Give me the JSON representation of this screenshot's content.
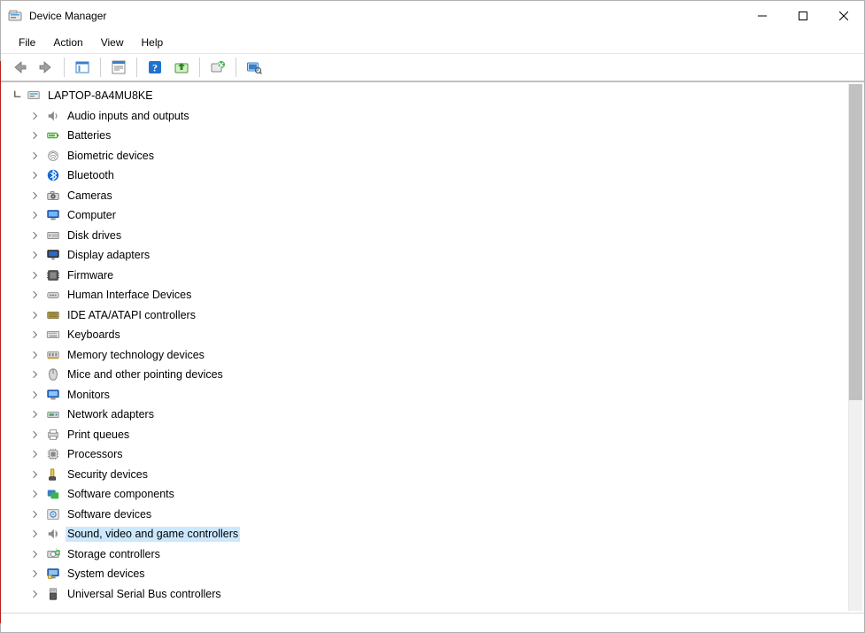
{
  "window": {
    "title": "Device Manager"
  },
  "menu": {
    "items": [
      {
        "label": "File"
      },
      {
        "label": "Action"
      },
      {
        "label": "View"
      },
      {
        "label": "Help"
      }
    ]
  },
  "toolbar": {
    "back": "back-icon",
    "forward": "forward-icon",
    "show_hide_console": "console-tree-icon",
    "properties": "properties-icon",
    "help": "help-icon",
    "update_driver": "update-driver-icon",
    "uninstall": "uninstall-icon",
    "scan": "scan-icon"
  },
  "tree": {
    "root": {
      "label": "LAPTOP-8A4MU8KE",
      "expanded": true
    },
    "categories": [
      {
        "icon": "audio-icon",
        "label": "Audio inputs and outputs"
      },
      {
        "icon": "battery-icon",
        "label": "Batteries"
      },
      {
        "icon": "biometric-icon",
        "label": "Biometric devices"
      },
      {
        "icon": "bluetooth-icon",
        "label": "Bluetooth"
      },
      {
        "icon": "camera-icon",
        "label": "Cameras"
      },
      {
        "icon": "computer-icon",
        "label": "Computer"
      },
      {
        "icon": "disk-icon",
        "label": "Disk drives"
      },
      {
        "icon": "display-icon",
        "label": "Display adapters"
      },
      {
        "icon": "firmware-icon",
        "label": "Firmware"
      },
      {
        "icon": "hid-icon",
        "label": "Human Interface Devices"
      },
      {
        "icon": "ide-icon",
        "label": "IDE ATA/ATAPI controllers"
      },
      {
        "icon": "keyboard-icon",
        "label": "Keyboards"
      },
      {
        "icon": "memory-icon",
        "label": "Memory technology devices"
      },
      {
        "icon": "mouse-icon",
        "label": "Mice and other pointing devices"
      },
      {
        "icon": "monitor-icon",
        "label": "Monitors"
      },
      {
        "icon": "network-icon",
        "label": "Network adapters"
      },
      {
        "icon": "print-icon",
        "label": "Print queues"
      },
      {
        "icon": "processor-icon",
        "label": "Processors"
      },
      {
        "icon": "security-icon",
        "label": "Security devices"
      },
      {
        "icon": "softcomp-icon",
        "label": "Software components"
      },
      {
        "icon": "softdev-icon",
        "label": "Software devices"
      },
      {
        "icon": "sound-icon",
        "label": "Sound, video and game controllers",
        "selected": true
      },
      {
        "icon": "storage-icon",
        "label": "Storage controllers"
      },
      {
        "icon": "system-icon",
        "label": "System devices"
      },
      {
        "icon": "usb-icon",
        "label": "Universal Serial Bus controllers"
      }
    ]
  }
}
